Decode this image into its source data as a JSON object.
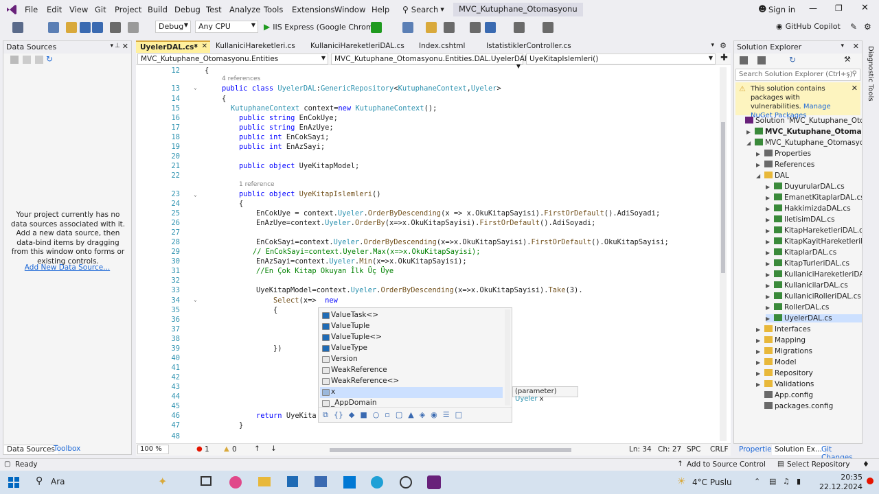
{
  "menu": {
    "items": [
      "File",
      "Edit",
      "View",
      "Git",
      "Project",
      "Build",
      "Debug",
      "Test",
      "Analyze",
      "Tools",
      "Extensions",
      "Window",
      "Help"
    ],
    "search_label": "Search",
    "solution_name": "MVC_Kutuphane_Otomasyonu",
    "sign_in": "Sign in"
  },
  "toolbar": {
    "config": "Debug",
    "platform": "Any CPU",
    "run_label": "IIS Express (Google Chrome)",
    "copilot": "GitHub Copilot"
  },
  "data_sources": {
    "title": "Data Sources",
    "message": "Your project currently has no data sources associated with it. Add a new data source, then data-bind items by dragging from this window onto forms or existing controls.",
    "link": "Add New Data Source...",
    "tab_active": "Data Sources",
    "tab_other": "Toolbox"
  },
  "editor": {
    "tabs": [
      "UyelerDAL.cs*",
      "KullaniciHareketleri.cs",
      "KullaniciHareketleriDAL.cs",
      "Index.cshtml",
      "IstatistiklerController.cs"
    ],
    "nav_project": "MVC_Kutuphane_Otomasyonu.Entities",
    "nav_class": "MVC_Kutuphane_Otomasyonu.Entities.DAL.UyelerDAL",
    "nav_member": "UyeKitapIslemleri()",
    "zoom": "100 %",
    "errors": "1",
    "warnings": "0",
    "ln": "Ln: 34",
    "ch": "Ch: 27",
    "spc": "SPC",
    "crlf": "CRLF"
  },
  "code_lines": [
    {
      "n": "12",
      "t": "{"
    },
    {
      "n": "",
      "t": "4 references"
    },
    {
      "n": "13",
      "t": "public class UyelerDAL:GenericRepository<KutuphaneContext,Uyeler>"
    },
    {
      "n": "14",
      "t": "{"
    },
    {
      "n": "15",
      "t": "KutuphaneContext context=new KutuphaneContext();"
    },
    {
      "n": "16",
      "t": "public string EnCokUye;"
    },
    {
      "n": "17",
      "t": "public string EnAzUye;"
    },
    {
      "n": "18",
      "t": "public int EnCokSayi;"
    },
    {
      "n": "19",
      "t": "public int EnAzSayi;"
    },
    {
      "n": "20",
      "t": ""
    },
    {
      "n": "21",
      "t": "public object UyeKitapModel;"
    },
    {
      "n": "22",
      "t": ""
    },
    {
      "n": "",
      "t": "1 reference"
    },
    {
      "n": "23",
      "t": "public object UyeKitapIslemleri()"
    },
    {
      "n": "24",
      "t": "{"
    },
    {
      "n": "25",
      "t": "EnCokUye = context.Uyeler.OrderByDescending(x => x.OkuKitapSayisi).FirstOrDefault().AdiSoyadi;"
    },
    {
      "n": "26",
      "t": "EnAzUye=context.Uyeler.OrderBy(x=>x.OkuKitapSayisi).FirstOrDefault().AdiSoyadi;"
    },
    {
      "n": "27",
      "t": ""
    },
    {
      "n": "28",
      "t": "EnCokSayi=context.Uyeler.OrderByDescending(x=>x.OkuKitapSayisi).FirstOrDefault().OkuKitapSayisi;"
    },
    {
      "n": "29",
      "t": "// EnCokSayi=context.Uyeler.Max(x=>x.OkuKitapSayisi);"
    },
    {
      "n": "30",
      "t": "EnAzSayi=context.Uyeler.Min(x=>x.OkuKitapSayisi);"
    },
    {
      "n": "31",
      "t": "//En Çok Kitap Okuyan İlk Üç Üye"
    },
    {
      "n": "32",
      "t": ""
    },
    {
      "n": "33",
      "t": "UyeKitapModel=context.Uyeler.OrderByDescending(x=>x.OkuKitapSayisi).Take(3)."
    },
    {
      "n": "34",
      "t": "Select(x=>  new"
    },
    {
      "n": "35",
      "t": "{"
    },
    {
      "n": "36",
      "t": ""
    },
    {
      "n": "37",
      "t": ""
    },
    {
      "n": "38",
      "t": ""
    },
    {
      "n": "39",
      "t": "})"
    },
    {
      "n": "40",
      "t": ""
    },
    {
      "n": "41",
      "t": ""
    },
    {
      "n": "42",
      "t": ""
    },
    {
      "n": "43",
      "t": ""
    },
    {
      "n": "44",
      "t": ""
    },
    {
      "n": "45",
      "t": ""
    },
    {
      "n": "46",
      "t": "return UyeKita"
    },
    {
      "n": "47",
      "t": "}"
    },
    {
      "n": "48",
      "t": ""
    }
  ],
  "completion": {
    "items": [
      "ValueTask<>",
      "ValueTuple",
      "ValueTuple<>",
      "ValueType",
      "Version",
      "WeakReference",
      "WeakReference<>",
      "x",
      "_AppDomain"
    ],
    "selected": "x",
    "tooltip_prefix": "(parameter) ",
    "tooltip_type": "Uyeler",
    "tooltip_name": " x"
  },
  "solution_explorer": {
    "title": "Solution Explorer",
    "search_placeholder": "Search Solution Explorer (Ctrl+ş)",
    "warning": "This solution contains packages with vulnerabilities.",
    "warning_link": "Manage NuGet Packages",
    "tree": [
      {
        "label": "Solution 'MVC_Kutuphane_Otomasyonu'",
        "lvl": 0,
        "tri": "",
        "icon": "solution-icon"
      },
      {
        "label": "MVC_Kutuphane_Otomasyonu",
        "lvl": 1,
        "tri": "▶",
        "icon": "project-icon",
        "bold": true
      },
      {
        "label": "MVC_Kutuphane_Otomasyonu.Entities",
        "lvl": 1,
        "tri": "◢",
        "icon": "project-icon"
      },
      {
        "label": "Properties",
        "lvl": 2,
        "tri": "▶",
        "icon": "wrench-icon"
      },
      {
        "label": "References",
        "lvl": 2,
        "tri": "▶",
        "icon": "references-icon"
      },
      {
        "label": "DAL",
        "lvl": 2,
        "tri": "◢",
        "icon": "folder-icon"
      },
      {
        "label": "DuyurularDAL.cs",
        "lvl": 3,
        "tri": "▶",
        "icon": "csharp-icon"
      },
      {
        "label": "EmanetKitaplarDAL.cs",
        "lvl": 3,
        "tri": "▶",
        "icon": "csharp-icon"
      },
      {
        "label": "HakkimizdaDAL.cs",
        "lvl": 3,
        "tri": "▶",
        "icon": "csharp-icon"
      },
      {
        "label": "IletisimDAL.cs",
        "lvl": 3,
        "tri": "▶",
        "icon": "csharp-icon"
      },
      {
        "label": "KitapHareketleriDAL.cs",
        "lvl": 3,
        "tri": "▶",
        "icon": "csharp-icon"
      },
      {
        "label": "KitapKayitHareketleriDAL.cs",
        "lvl": 3,
        "tri": "▶",
        "icon": "csharp-icon"
      },
      {
        "label": "KitaplarDAL.cs",
        "lvl": 3,
        "tri": "▶",
        "icon": "csharp-icon"
      },
      {
        "label": "KitapTurleriDAL.cs",
        "lvl": 3,
        "tri": "▶",
        "icon": "csharp-icon"
      },
      {
        "label": "KullaniciHareketleriDAL.cs",
        "lvl": 3,
        "tri": "▶",
        "icon": "csharp-icon"
      },
      {
        "label": "KullanicilarDAL.cs",
        "lvl": 3,
        "tri": "▶",
        "icon": "csharp-icon"
      },
      {
        "label": "KullaniciRolleriDAL.cs",
        "lvl": 3,
        "tri": "▶",
        "icon": "csharp-icon"
      },
      {
        "label": "RollerDAL.cs",
        "lvl": 3,
        "tri": "▶",
        "icon": "csharp-icon"
      },
      {
        "label": "UyelerDAL.cs",
        "lvl": 3,
        "tri": "▶",
        "icon": "csharp-icon",
        "sel": true
      },
      {
        "label": "Interfaces",
        "lvl": 2,
        "tri": "▶",
        "icon": "folder-icon"
      },
      {
        "label": "Mapping",
        "lvl": 2,
        "tri": "▶",
        "icon": "folder-icon"
      },
      {
        "label": "Migrations",
        "lvl": 2,
        "tri": "▶",
        "icon": "folder-icon"
      },
      {
        "label": "Model",
        "lvl": 2,
        "tri": "▶",
        "icon": "folder-icon"
      },
      {
        "label": "Repository",
        "lvl": 2,
        "tri": "▶",
        "icon": "folder-icon"
      },
      {
        "label": "Validations",
        "lvl": 2,
        "tri": "▶",
        "icon": "folder-icon"
      },
      {
        "label": "App.config",
        "lvl": 2,
        "tri": "",
        "icon": "config-icon"
      },
      {
        "label": "packages.config",
        "lvl": 2,
        "tri": "",
        "icon": "config-icon"
      }
    ],
    "bottom_tabs": [
      "Properties",
      "Solution Ex...",
      "Git Changes"
    ]
  },
  "diag_tools": "Diagnostic Tools",
  "statusbar": {
    "ready": "Ready",
    "source_control": "Add to Source Control",
    "select_repo": "Select Repository"
  },
  "taskbar": {
    "search": "Ara",
    "weather": "4°C  Puslu",
    "time": "20:35",
    "date": "22.12.2024"
  },
  "colors": {
    "accent": "#68217a",
    "selection": "#cce0ff",
    "keyword": "#0000ff",
    "type": "#2b91af",
    "comment": "#008000"
  }
}
